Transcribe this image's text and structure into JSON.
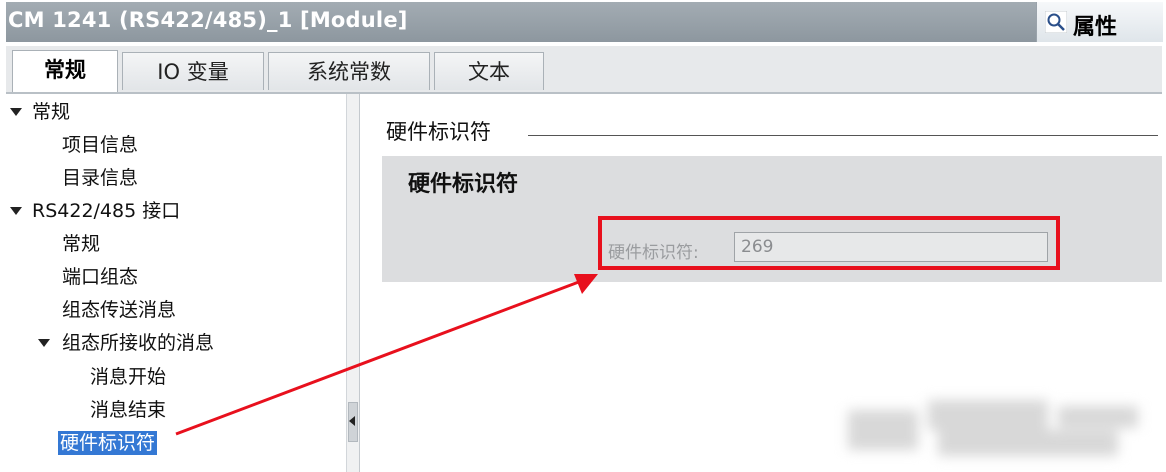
{
  "window": {
    "title": "CM 1241 (RS422/485)_1 [Module]",
    "properties_label": "属性",
    "properties_icon": "magnifier-icon"
  },
  "tabs": [
    {
      "label": "常规",
      "active": true
    },
    {
      "label": "IO 变量",
      "active": false
    },
    {
      "label": "系统常数",
      "active": false
    },
    {
      "label": "文本",
      "active": false
    }
  ],
  "tree": {
    "general": "常规",
    "project_info": "项目信息",
    "catalog_info": "目录信息",
    "rs_interface": "RS422/485 接口",
    "rs_general": "常规",
    "port_config": "端口组态",
    "send_config": "组态传送消息",
    "receive_config": "组态所接收的消息",
    "msg_start": "消息开始",
    "msg_end": "消息结束",
    "hw_identifier": "硬件标识符"
  },
  "content": {
    "section_title": "硬件标识符",
    "panel_heading": "硬件标识符",
    "field_label": "硬件标识符:",
    "field_value": "269"
  },
  "colors": {
    "highlight_box": "#e8101d",
    "selection": "#3478d4",
    "title_bar": "#9aa3ab"
  }
}
